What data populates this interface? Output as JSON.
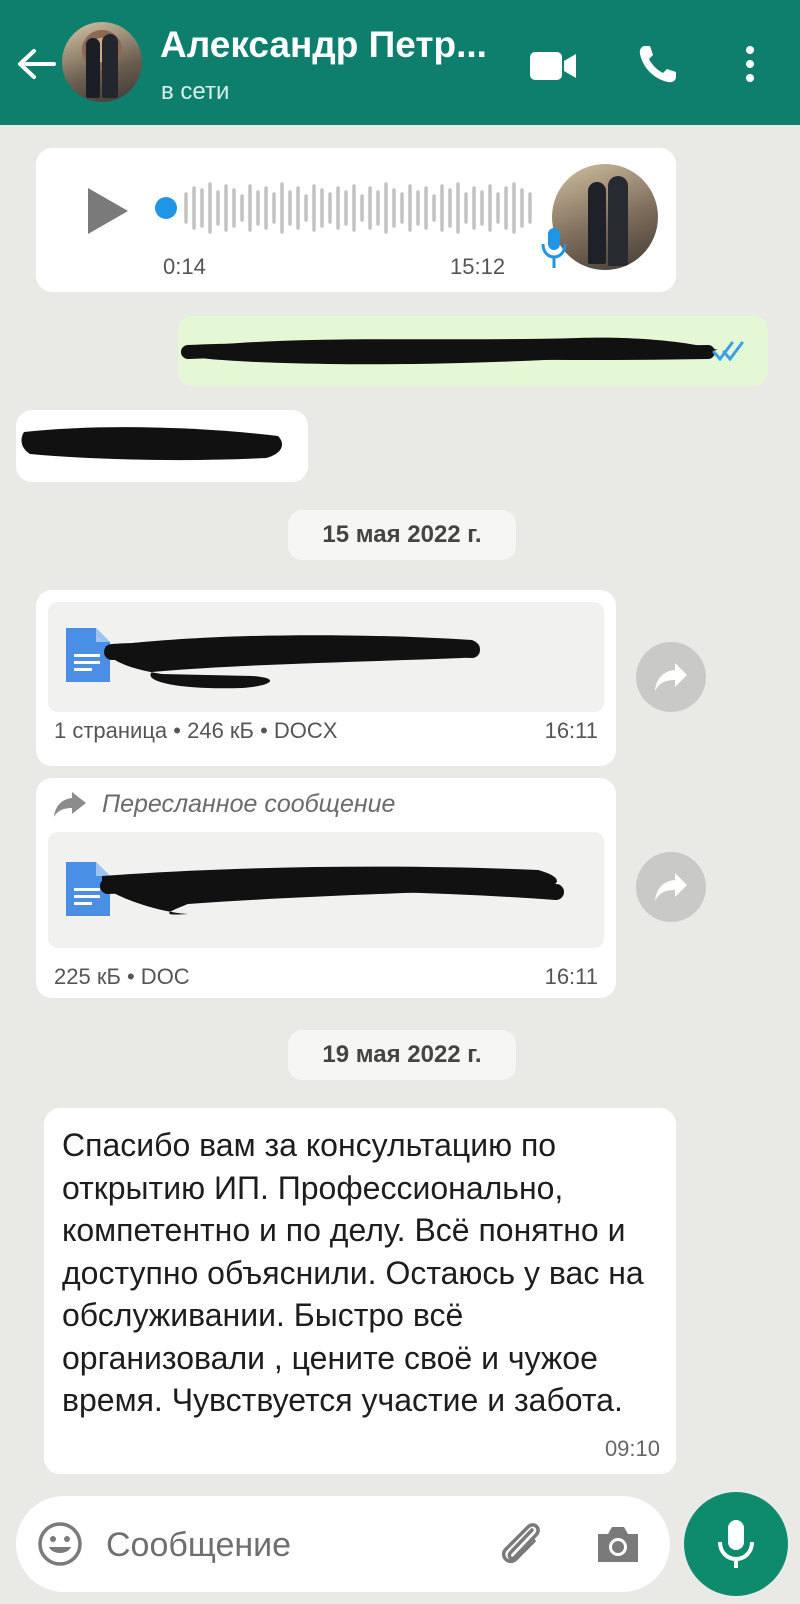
{
  "header": {
    "name": "Александр Петр...",
    "status": "в сети"
  },
  "voice_message": {
    "duration": "0:14",
    "time": "15:12"
  },
  "date_separators": [
    "15 мая 2022 г.",
    "19 мая 2022 г."
  ],
  "documents": [
    {
      "meta": "1 страница • 246 кБ • DOCX",
      "time": "16:11"
    },
    {
      "forwarded_label": "Пересланное сообщение",
      "meta": "225 кБ • DOC",
      "time": "16:11"
    }
  ],
  "text_message": {
    "text": "Спасибо вам за консультацию по открытию ИП. Профессионально, компетентно и по делу. Всё понятно и доступно объяснили. Остаюсь у вас на обслуживании. Быстро всё организовали , цените своё и чужое время. Чувствуется участие и забота.",
    "time": "09:10"
  },
  "input": {
    "placeholder": "Сообщение"
  },
  "colors": {
    "header": "#0e7f6c",
    "background": "#e9eae6",
    "outgoing_bubble": "#e5f8d6",
    "accent": "#0e8a6d",
    "voice_accent": "#1f95e5"
  },
  "icons": [
    "back-icon",
    "video-icon",
    "call-icon",
    "menu-icon",
    "play-icon",
    "mic-icon",
    "double-check-icon",
    "document-icon",
    "forward-icon",
    "emoji-icon",
    "attach-icon",
    "camera-icon"
  ]
}
